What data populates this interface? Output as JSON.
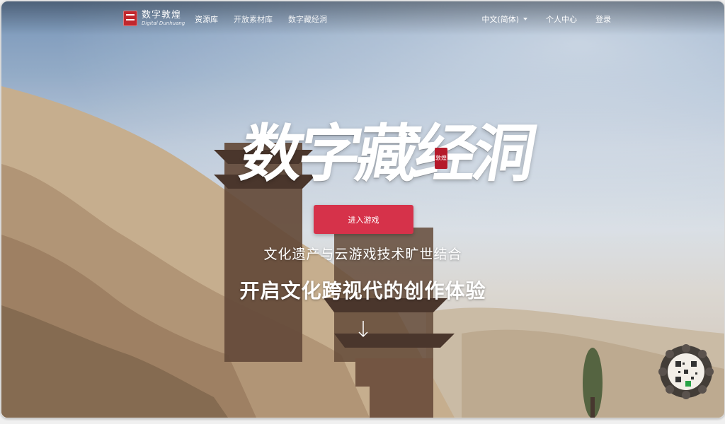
{
  "topbar": {
    "logo": {
      "cn": "数字敦煌",
      "en": "Digital Dunhuang"
    },
    "nav": [
      {
        "label": "资源库",
        "active": true
      },
      {
        "label": "开放素材库",
        "active": false
      },
      {
        "label": "数字藏经洞",
        "active": false
      }
    ],
    "right": {
      "language": "中文(简体)",
      "user_center": "个人中心",
      "login": "登录"
    }
  },
  "hero": {
    "title": "数字藏经洞",
    "seal": "敦煌",
    "enter_button": "进入游戏",
    "subtitle": "文化遗产与云游戏技术旷世结合",
    "headline": "开启文化跨视代的创作体验"
  },
  "colors": {
    "accent_button": "#d6324a",
    "seal_red": "#b5192a"
  },
  "icons": {
    "scroll": "down-arrow-icon",
    "badge": "wechat-qr-badge-icon"
  }
}
